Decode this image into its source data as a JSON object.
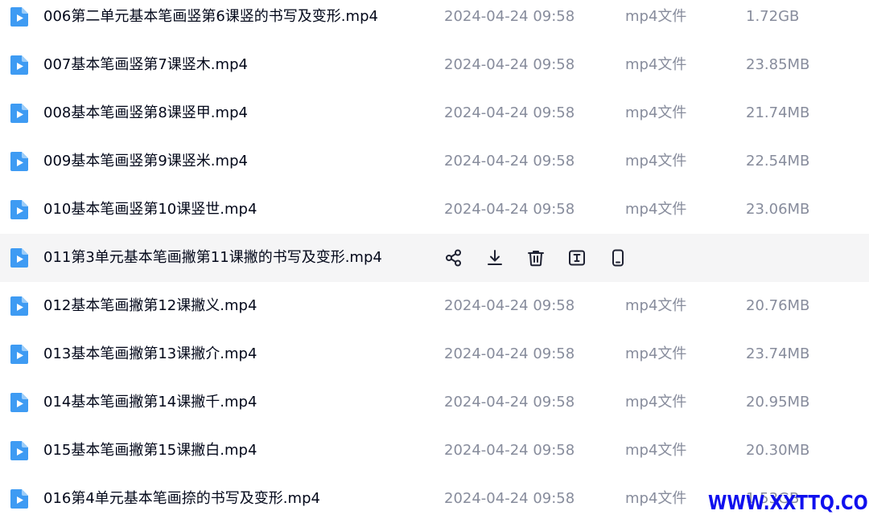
{
  "files": [
    {
      "name": "006第二单元基本笔画竖第6课竖的书写及变形.mp4",
      "date": "2024-04-24 09:58",
      "type": "mp4文件",
      "size": "1.72GB",
      "hovered": false
    },
    {
      "name": "007基本笔画竖第7课竖木.mp4",
      "date": "2024-04-24 09:58",
      "type": "mp4文件",
      "size": "23.85MB",
      "hovered": false
    },
    {
      "name": "008基本笔画竖第8课竖甲.mp4",
      "date": "2024-04-24 09:58",
      "type": "mp4文件",
      "size": "21.74MB",
      "hovered": false
    },
    {
      "name": "009基本笔画竖第9课竖米.mp4",
      "date": "2024-04-24 09:58",
      "type": "mp4文件",
      "size": "22.54MB",
      "hovered": false
    },
    {
      "name": "010基本笔画竖第10课竖世.mp4",
      "date": "2024-04-24 09:58",
      "type": "mp4文件",
      "size": "23.06MB",
      "hovered": false
    },
    {
      "name": "011第3单元基本笔画撇第11课撇的书写及变形.mp4",
      "date": "",
      "type": "",
      "size": "",
      "hovered": true
    },
    {
      "name": "012基本笔画撇第12课撇义.mp4",
      "date": "2024-04-24 09:58",
      "type": "mp4文件",
      "size": "20.76MB",
      "hovered": false
    },
    {
      "name": "013基本笔画撇第13课撇介.mp4",
      "date": "2024-04-24 09:58",
      "type": "mp4文件",
      "size": "23.74MB",
      "hovered": false
    },
    {
      "name": "014基本笔画撇第14课撇千.mp4",
      "date": "2024-04-24 09:58",
      "type": "mp4文件",
      "size": "20.95MB",
      "hovered": false
    },
    {
      "name": "015基本笔画撇第15课撇白.mp4",
      "date": "2024-04-24 09:58",
      "type": "mp4文件",
      "size": "20.30MB",
      "hovered": false
    },
    {
      "name": "016第4单元基本笔画捺的书写及变形.mp4",
      "date": "2024-04-24 09:58",
      "type": "mp4文件",
      "size": "1.53GB",
      "hovered": false
    }
  ],
  "row_actions": [
    {
      "name": "share",
      "icon": "share-icon"
    },
    {
      "name": "download",
      "icon": "download-icon"
    },
    {
      "name": "delete",
      "icon": "trash-icon"
    },
    {
      "name": "rename",
      "icon": "rename-icon"
    },
    {
      "name": "more",
      "icon": "phone-icon"
    }
  ],
  "colors": {
    "file_icon": "#3e9bf3",
    "name_text": "#03081a",
    "meta_text": "#878c9c",
    "hover_bg": "#f5f5f6",
    "action_icon": "#1f2233",
    "watermark": "#1010ee"
  },
  "watermark": "WWW.XXTTQ.COM"
}
